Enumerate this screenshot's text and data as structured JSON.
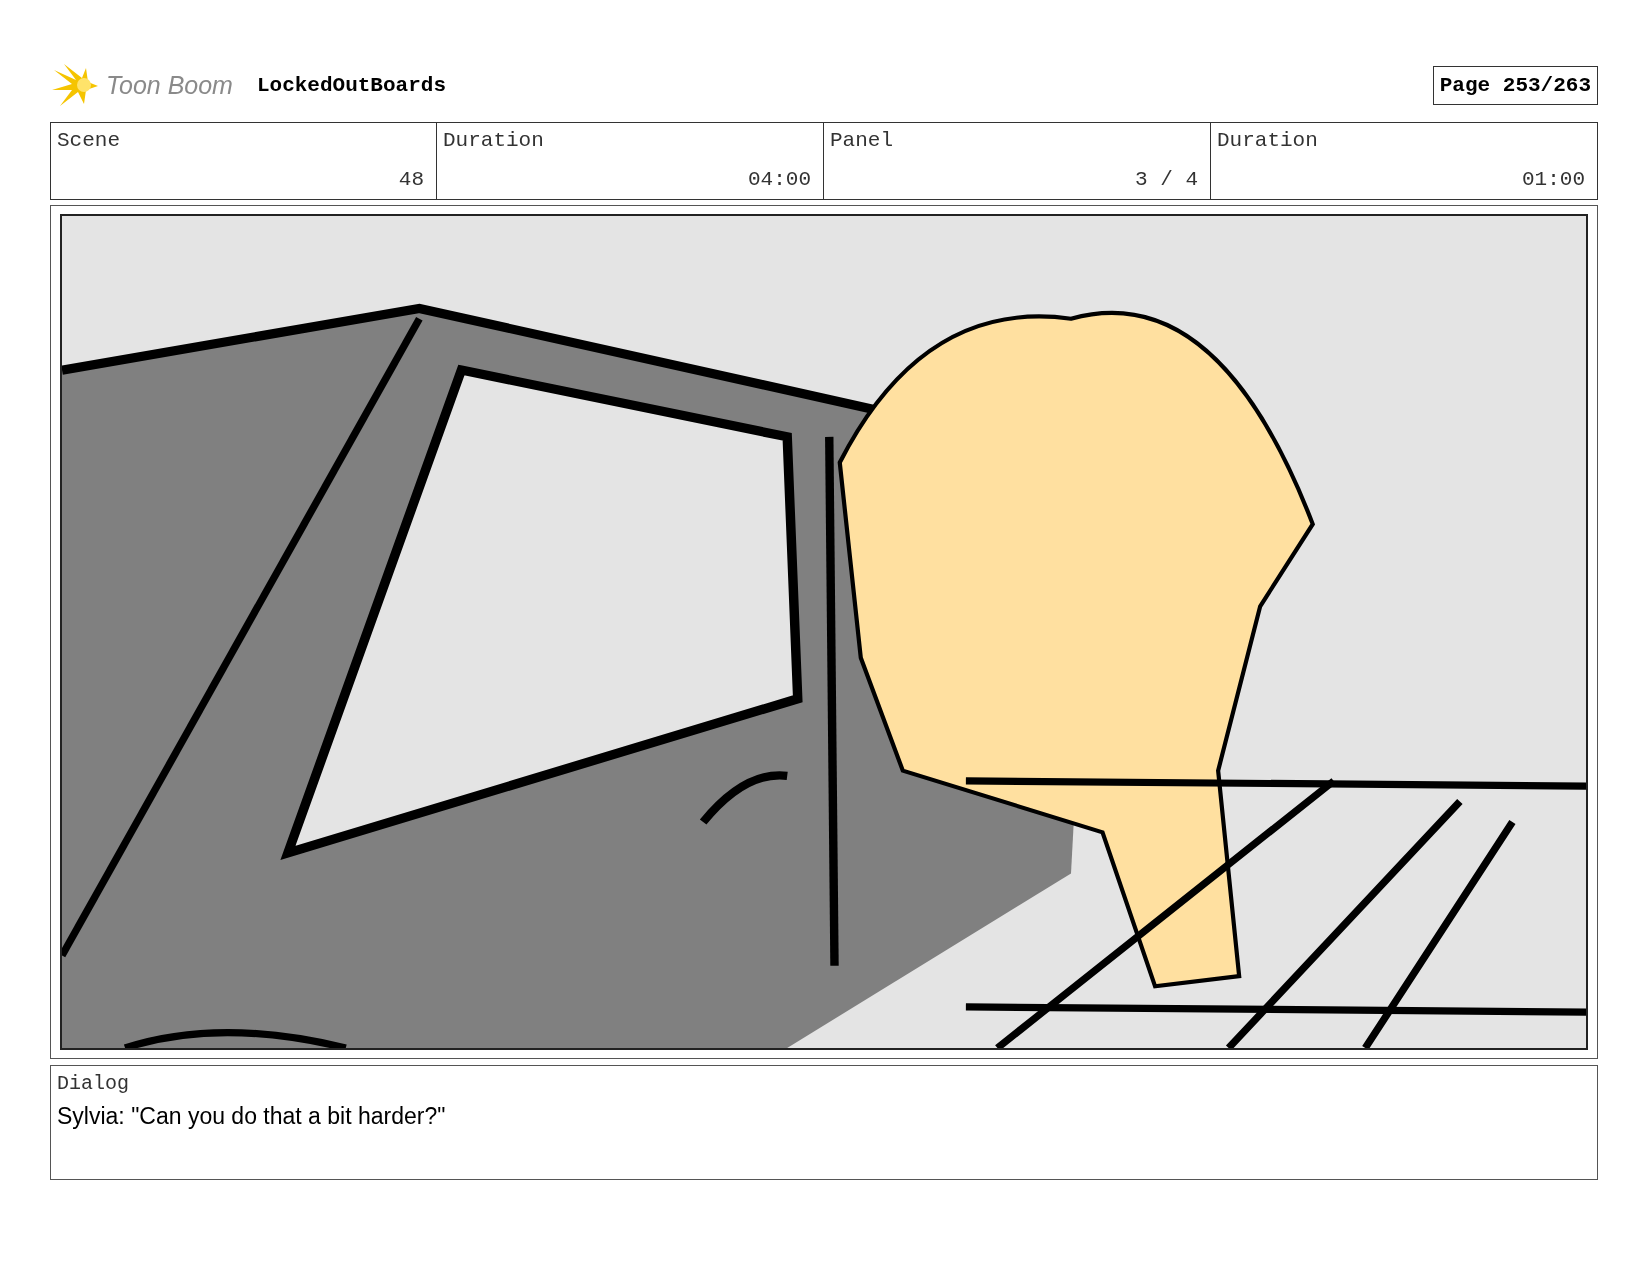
{
  "header": {
    "logo_text": "Toon Boom",
    "project": "LockedOutBoards",
    "page": "Page 253/263"
  },
  "info": [
    {
      "label": "Scene",
      "value": "48"
    },
    {
      "label": "Duration",
      "value": "04:00"
    },
    {
      "label": "Panel",
      "value": "3 / 4"
    },
    {
      "label": "Duration",
      "value": "01:00"
    }
  ],
  "panel": {
    "kind": "figure"
  },
  "dialog": {
    "label": "Dialog",
    "text": "Sylvia: \"Can you do that a bit harder?\""
  }
}
